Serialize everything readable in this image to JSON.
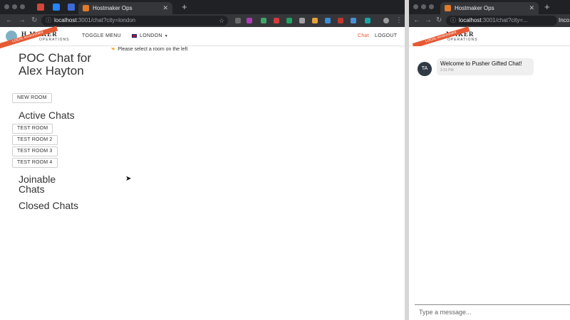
{
  "left_window": {
    "tab_title": "Hostmaker Ops",
    "url_host": "localhost",
    "url_path": ":3001/chat?city=london",
    "app": {
      "logo_text": "H   MAKER",
      "logo_sub": "OPERATIONS",
      "ribbon": "LOCAL environment",
      "toggle_menu": "TOGGLE MENU",
      "city": "LONDON",
      "chat_link": "Chat",
      "logout": "LOGOUT"
    },
    "main": {
      "title": "POC Chat for Alex Hayton",
      "new_room": "NEW ROOM",
      "active_heading": "Active Chats",
      "rooms": [
        "TEST ROOM",
        "TEST ROOM 2",
        "TEST ROOM 3",
        "TEST ROOM 4"
      ],
      "joinable_heading": "Joinable Chats",
      "closed_heading": "Closed Chats",
      "hint": "Please select a room on the left"
    }
  },
  "right_window": {
    "tab_title": "Hostmaker Ops",
    "url_host": "localhost",
    "url_path": ":3001/chat?city=...",
    "incognito_text": "Inco",
    "app": {
      "logo_text": "MAKER",
      "logo_sub": "OPERATIONS",
      "ribbon": "LOCAL environment"
    },
    "chat": {
      "avatar_initials": "TA",
      "message": "Welcome to Pusher Gifted Chat!",
      "time": "2:31 PM",
      "input_placeholder": "Type a message..."
    }
  },
  "colors": {
    "accent": "#e55a34",
    "tabbar": "#202124",
    "toolbar": "#35363a"
  }
}
